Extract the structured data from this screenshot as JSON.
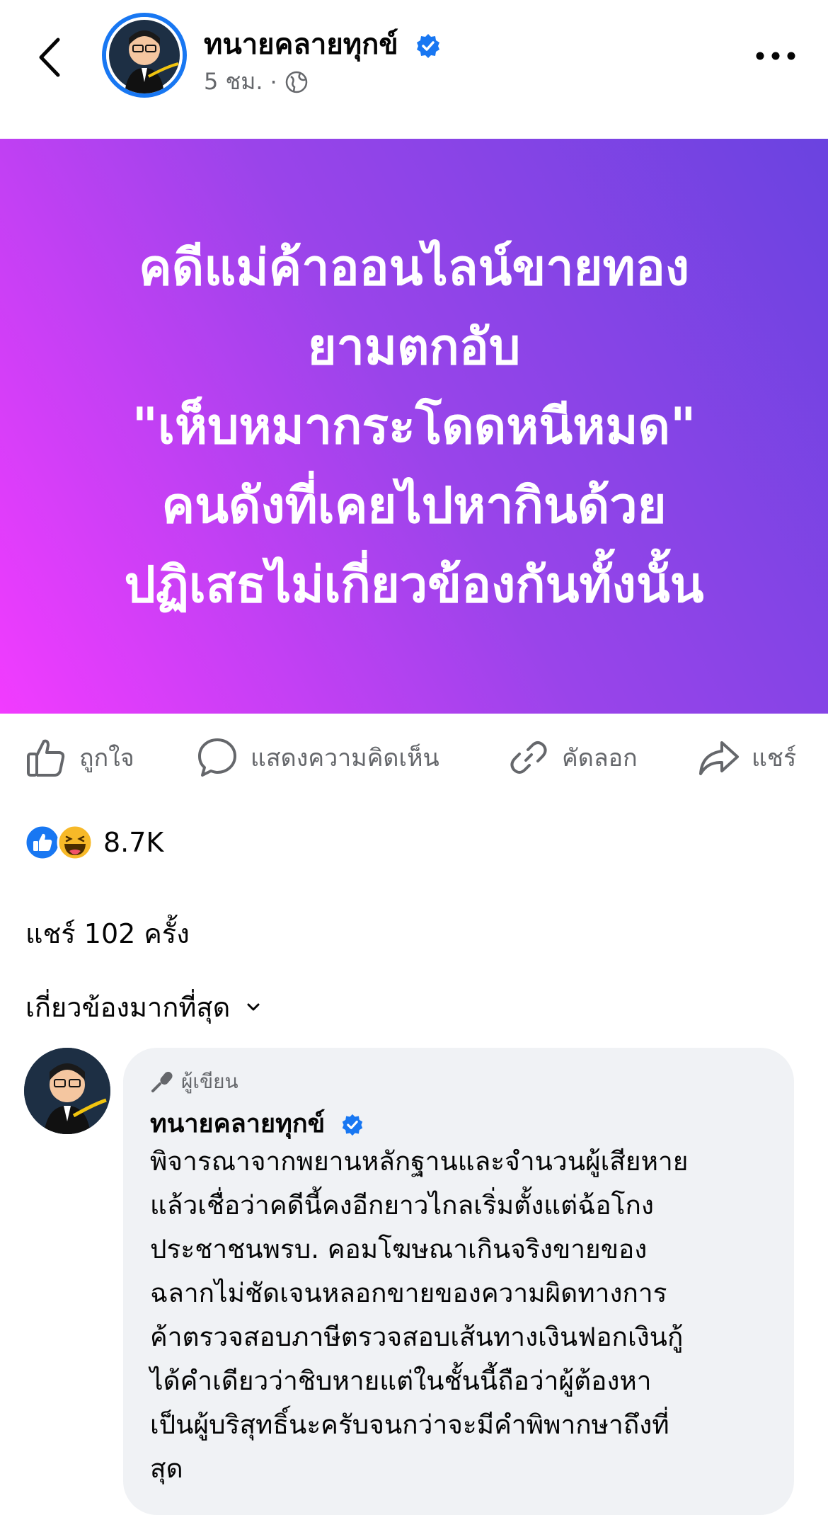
{
  "header": {
    "page_name": "ทนายคลายทุกข์",
    "time": "5 ชม.",
    "separator": "·",
    "privacy_icon": "globe-icon",
    "back_icon": "chevron-left-icon",
    "more_icon": "more-dots-icon"
  },
  "banner": {
    "lines": [
      "คดีแม่ค้าออนไลน์ขายทอง",
      "ยามตกอับ",
      "\"เห็บหมากระโดดหนีหมด\"",
      "คนดังที่เคยไปหากินด้วย",
      "ปฏิเสธไม่เกี่ยวข้องกันทั้งนั้น"
    ],
    "gradient_colors": [
      "#f23bff",
      "#9a44ea",
      "#6a43e0"
    ]
  },
  "actions": {
    "like": "ถูกใจ",
    "comment": "แสดงความคิดเห็น",
    "copy": "คัดลอก",
    "share": "แชร์"
  },
  "reactions": {
    "icons": [
      "like-reaction-icon",
      "haha-reaction-icon"
    ],
    "count": "8.7K"
  },
  "shares": "แชร์ 102 ครั้ง",
  "sort": {
    "label": "เกี่ยวข้องมากที่สุด"
  },
  "comment": {
    "badge": "ผู้เขียน",
    "author": "ทนายคลายทุกข์",
    "lines": [
      "พิจารณาจากพยานหลักฐานและจำนวนผู้เสียหาย",
      "แล้วเชื่อว่าคดีนี้คงอีกยาวไกลเริ่มตั้งแต่ฉ้อโกง",
      "ประชาชนพรบ. คอมโฆษณาเกินจริงขายของ",
      "ฉลากไม่ชัดเจนหลอกขายของความผิดทางการ",
      "ค้าตรวจสอบภาษีตรวจสอบเส้นทางเงินฟอกเงินกู้",
      "ได้คำเดียวว่าชิบหายแต่ในชั้นนี้ถือว่าผู้ต้องหา",
      "เป็นผู้บริสุทธิ์นะครับจนกว่าจะมีคำพิพากษาถึงที่",
      "สุด"
    ]
  },
  "colors": {
    "verified": "#1877f2",
    "secondary_text": "#65676b",
    "bubble": "#f0f2f5"
  }
}
